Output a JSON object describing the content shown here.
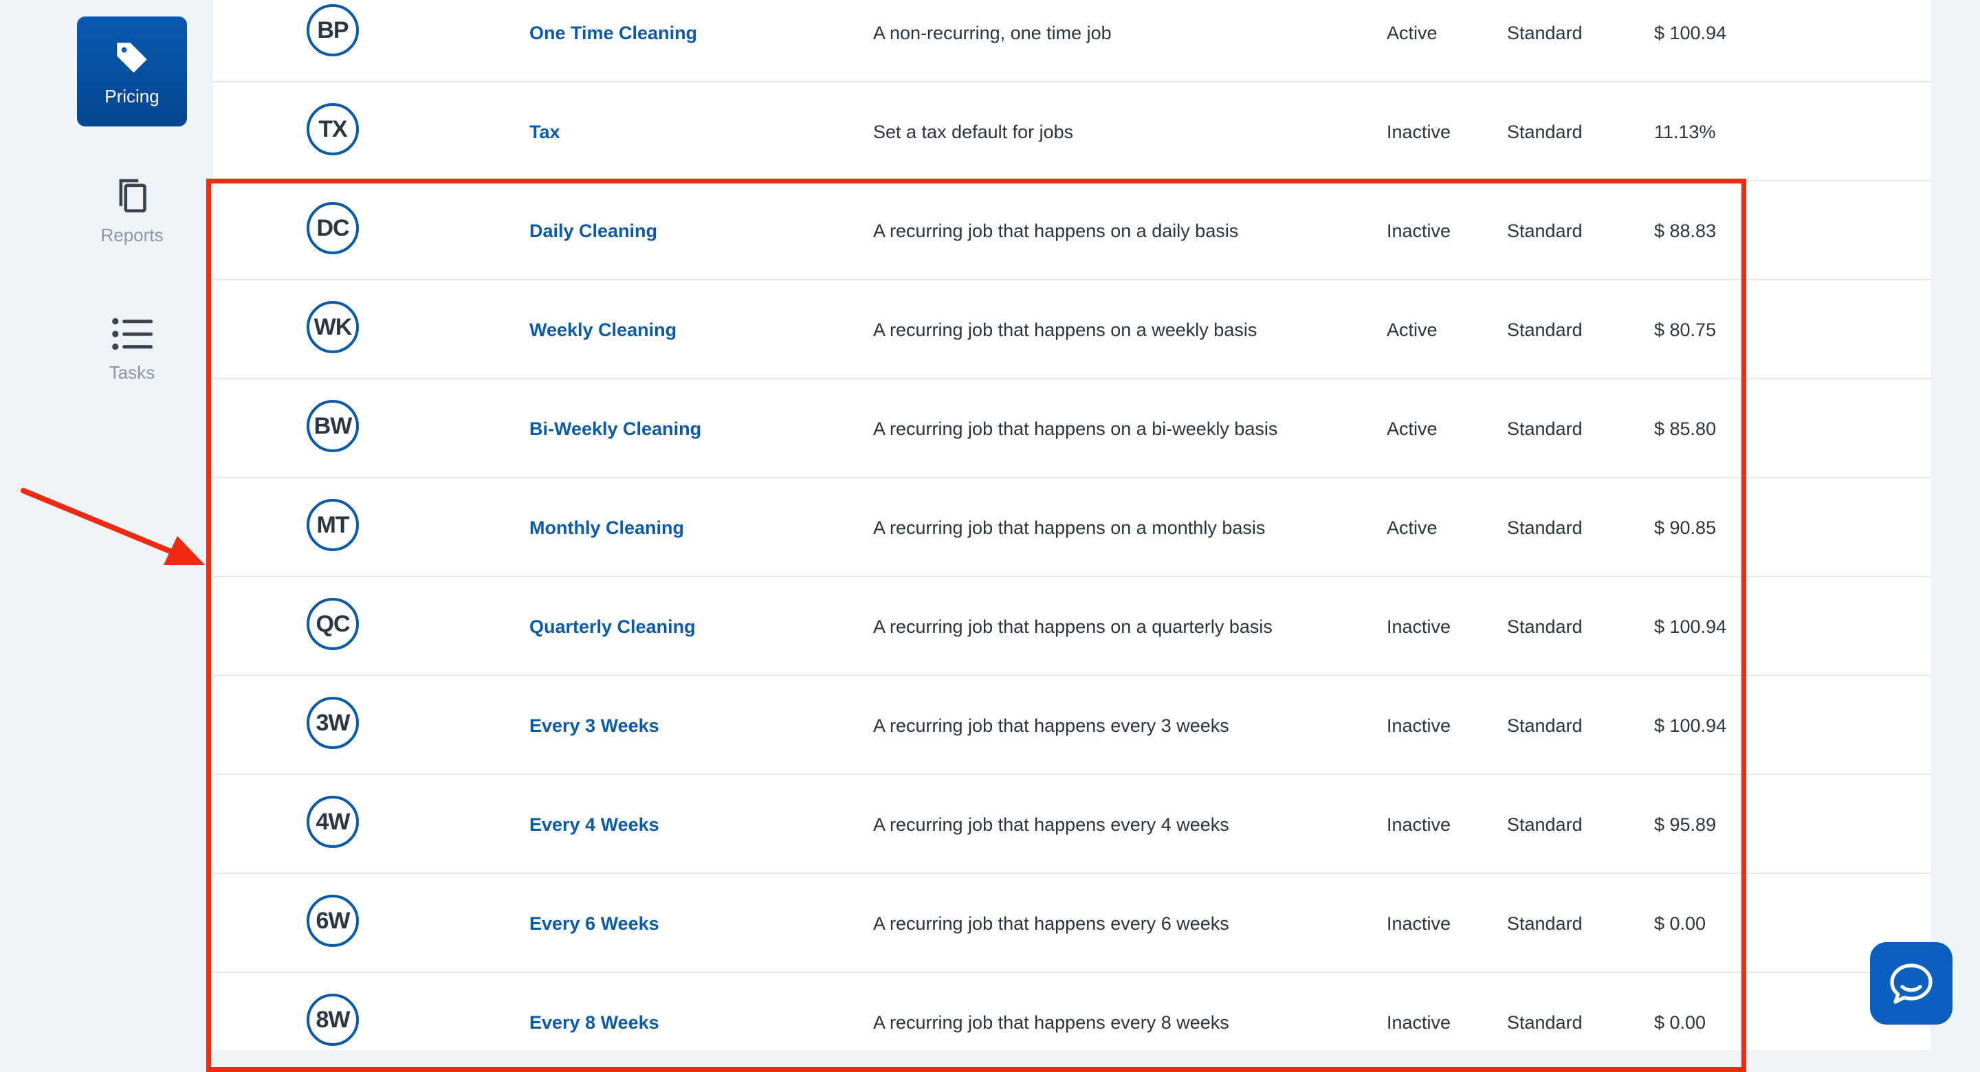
{
  "sidebar": {
    "items": [
      {
        "label": "Pricing",
        "icon": "price-tag-icon",
        "active": true
      },
      {
        "label": "Reports",
        "icon": "copy-icon",
        "active": false
      },
      {
        "label": "Tasks",
        "icon": "list-icon",
        "active": false
      }
    ]
  },
  "rows": [
    {
      "code": "BP",
      "name": "One Time Cleaning",
      "description": "A non-recurring, one time job",
      "status": "Active",
      "type": "Standard",
      "price": "$ 100.94"
    },
    {
      "code": "TX",
      "name": "Tax",
      "description": "Set a tax default for jobs",
      "status": "Inactive",
      "type": "Standard",
      "price": "11.13%"
    },
    {
      "code": "DC",
      "name": "Daily Cleaning",
      "description": "A recurring job that happens on a daily basis",
      "status": "Inactive",
      "type": "Standard",
      "price": "$ 88.83"
    },
    {
      "code": "WK",
      "name": "Weekly Cleaning",
      "description": "A recurring job that happens on a weekly basis",
      "status": "Active",
      "type": "Standard",
      "price": "$ 80.75"
    },
    {
      "code": "BW",
      "name": "Bi-Weekly Cleaning",
      "description": "A recurring job that happens on a bi-weekly basis",
      "status": "Active",
      "type": "Standard",
      "price": "$ 85.80"
    },
    {
      "code": "MT",
      "name": "Monthly Cleaning",
      "description": "A recurring job that happens on a monthly basis",
      "status": "Active",
      "type": "Standard",
      "price": "$ 90.85"
    },
    {
      "code": "QC",
      "name": "Quarterly Cleaning",
      "description": "A recurring job that happens on a quarterly basis",
      "status": "Inactive",
      "type": "Standard",
      "price": "$ 100.94"
    },
    {
      "code": "3W",
      "name": "Every 3 Weeks",
      "description": "A recurring job that happens every 3 weeks",
      "status": "Inactive",
      "type": "Standard",
      "price": "$ 100.94"
    },
    {
      "code": "4W",
      "name": "Every 4 Weeks",
      "description": "A recurring job that happens every 4 weeks",
      "status": "Inactive",
      "type": "Standard",
      "price": "$ 95.89"
    },
    {
      "code": "6W",
      "name": "Every 6 Weeks",
      "description": "A recurring job that happens every 6 weeks",
      "status": "Inactive",
      "type": "Standard",
      "price": "$ 0.00"
    },
    {
      "code": "8W",
      "name": "Every 8 Weeks",
      "description": "A recurring job that happens every 8 weeks",
      "status": "Inactive",
      "type": "Standard",
      "price": "$ 0.00"
    }
  ],
  "annotation": {
    "color": "#f02a10"
  },
  "chat": {
    "icon": "chat-bubble-icon"
  },
  "colors": {
    "accent": "#0b5aa8",
    "sidebar_active": "#0a59b2",
    "chat_button": "#0a5fbf"
  }
}
